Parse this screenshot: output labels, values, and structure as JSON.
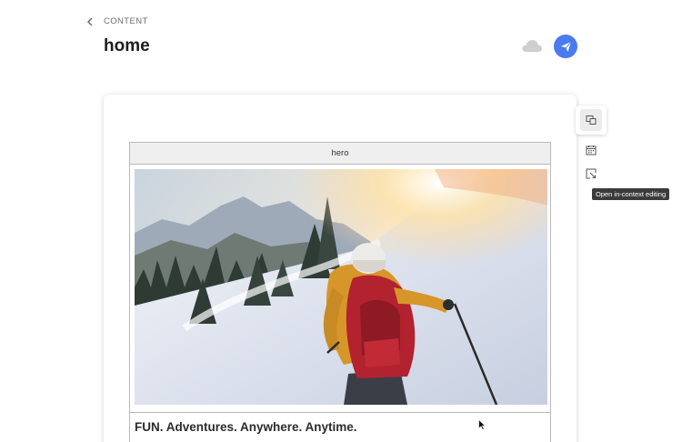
{
  "header": {
    "breadcrumb": "CONTENT",
    "title": "home"
  },
  "icons": {
    "back": "chevron-left-icon",
    "cloud": "cloud-icon",
    "publish": "paper-plane-icon",
    "properties": "properties-panel-icon",
    "schedule": "calendar-icon",
    "open_in_context": "open-in-context-icon"
  },
  "colors": {
    "accent": "#4a7bef",
    "cloud": "#cfcfcf",
    "tooltip_bg": "#3b3b3b"
  },
  "editor": {
    "component_label": "hero",
    "headline": "FUN. Adventures. Anywhere. Anytime."
  },
  "tooltip": {
    "text": "Open in-context editing"
  }
}
